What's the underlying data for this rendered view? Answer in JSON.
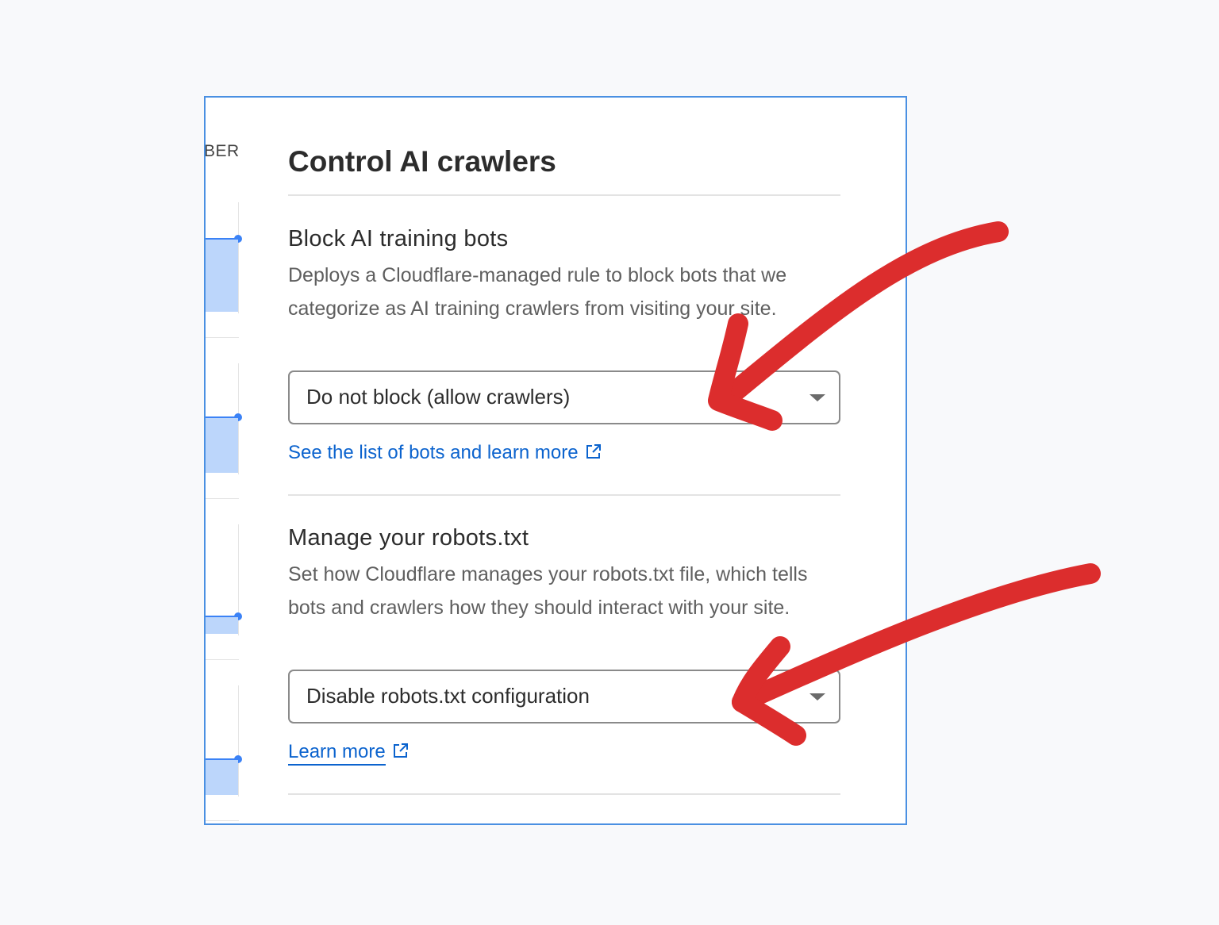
{
  "sidebar": {
    "truncated_label": "BER"
  },
  "panel": {
    "title": "Control AI crawlers"
  },
  "block_section": {
    "title": "Block AI training bots",
    "description": "Deploys a Cloudflare-managed rule to block bots that we categorize as AI training crawlers from visiting your site.",
    "select_value": "Do not block (allow crawlers)",
    "link_text": "See the list of bots and learn more",
    "link_icon": "external-link-icon"
  },
  "robots_section": {
    "title": "Manage your robots.txt",
    "description": "Set how Cloudflare manages your robots.txt file, which tells bots and crawlers how they should interact with your site.",
    "select_value": "Disable robots.txt configuration",
    "link_text": "Learn more",
    "link_icon": "external-link-icon"
  },
  "colors": {
    "frame_border": "#4a90e2",
    "link": "#0b63ce",
    "annotation_arrow": "#dc2d2d",
    "sparkline": "#3b82f6",
    "sparkline_fill": "#bcd6fb"
  }
}
